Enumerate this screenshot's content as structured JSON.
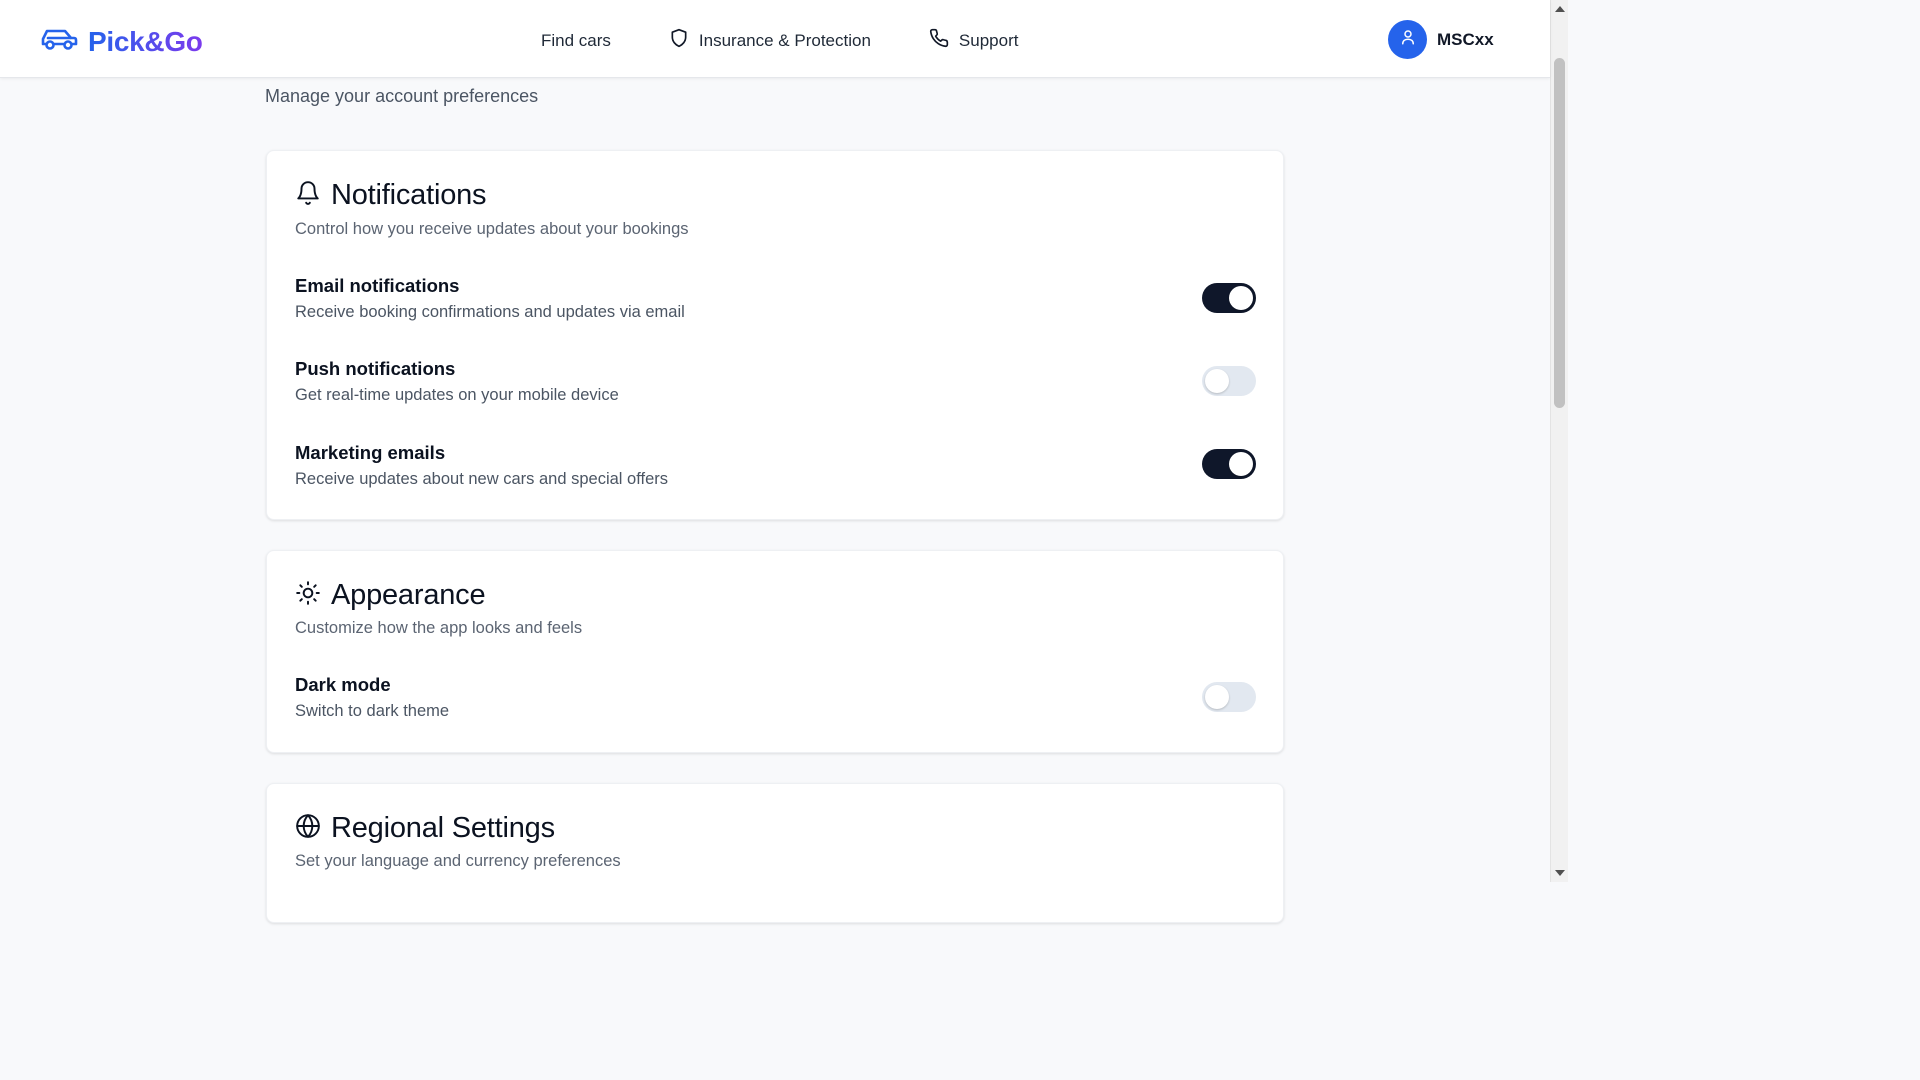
{
  "header": {
    "brand": "Pick&Go",
    "nav": [
      {
        "label": "Find cars",
        "icon": "none"
      },
      {
        "label": "Insurance & Protection",
        "icon": "shield-icon"
      },
      {
        "label": "Support",
        "icon": "phone-icon"
      }
    ],
    "user": {
      "name": "MSCxx",
      "icon": "user-icon"
    }
  },
  "page": {
    "subtitle": "Manage your account preferences"
  },
  "notifications": {
    "icon": "bell-icon",
    "title": "Notifications",
    "description": "Control how you receive updates about your bookings",
    "settings": [
      {
        "title": "Email notifications",
        "description": "Receive booking confirmations and updates via email",
        "enabled": true
      },
      {
        "title": "Push notifications",
        "description": "Get real-time updates on your mobile device",
        "enabled": false
      },
      {
        "title": "Marketing emails",
        "description": "Receive updates about new cars and special offers",
        "enabled": true
      }
    ]
  },
  "appearance": {
    "icon": "sun-icon",
    "title": "Appearance",
    "description": "Customize how the app looks and feels",
    "settings": [
      {
        "title": "Dark mode",
        "description": "Switch to dark theme",
        "enabled": false
      }
    ]
  },
  "regional": {
    "icon": "globe-icon",
    "title": "Regional Settings",
    "description": "Set your language and currency preferences"
  },
  "colors": {
    "brand_start": "#2563eb",
    "brand_end": "#7c3aed",
    "toggle_on": "#0f172a",
    "toggle_off": "#e2e8f0",
    "avatar": "#2563eb"
  }
}
